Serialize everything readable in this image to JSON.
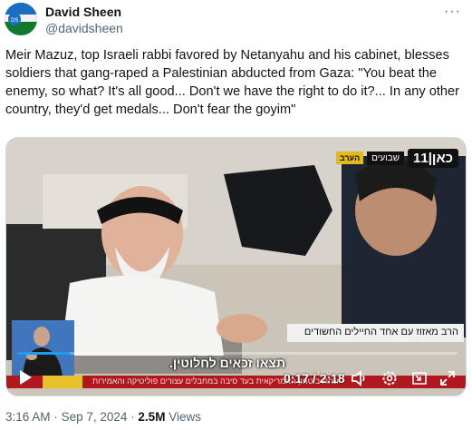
{
  "author": {
    "name": "David Sheen",
    "handle": "@davidsheen"
  },
  "more_glyph": "···",
  "tweet_text": "Meir Mazuz, top Israeli rabbi favored by Netanyahu and his cabinet, blesses soldiers that gang-raped a Palestinian abducted from Gaza: \"You beat the enemy, so what? It's all good... Don't we have the right to do it?... In any other country, they'd get medals... Don't fear the goyim\"",
  "video": {
    "channel_number": "כאן|11",
    "channel_label": "שבועים",
    "channel_tag": "הערב",
    "banner_text": "הרב מאזוז עם אחד החיילים החשודים",
    "subtitle_text": "תצאו זכאים לחלוטין.",
    "ticker_text": "ונחת ביטחון האמריקאית בעד סיבה במחבלים עצורים פוליטיקה והאמירות",
    "time": "0:17 / 2:18",
    "progress": 0.12,
    "controls": [
      "play-icon",
      "volume-icon",
      "settings-icon",
      "pip-icon",
      "fullscreen-icon"
    ]
  },
  "meta": {
    "time": "3:16 AM",
    "separator": "·",
    "date": "Sep 7, 2024",
    "views_count": "2.5M",
    "views_label": "Views"
  },
  "colors": {
    "accent": "#1d9bf0",
    "ticker": "#b1181d",
    "text": "#0f1419",
    "muted": "#536471"
  }
}
